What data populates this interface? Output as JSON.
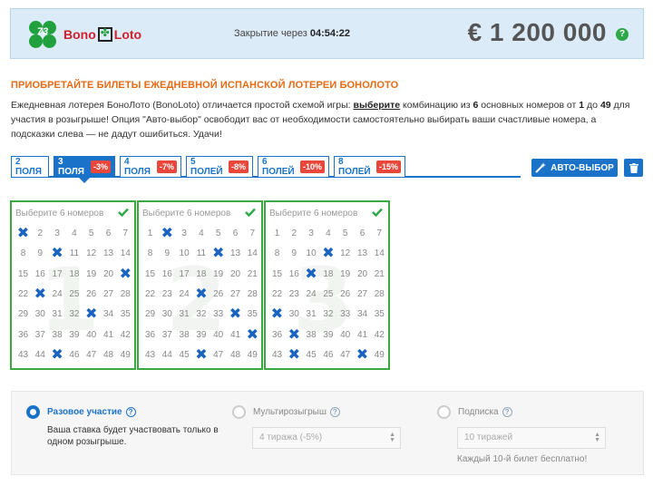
{
  "header": {
    "logo_number": "73",
    "brand_left": "Bono",
    "brand_right": "Loto",
    "closing_label": "Закрытие через",
    "closing_time": "04:54:22",
    "jackpot": "€ 1 200 000",
    "help": "?"
  },
  "title": "ПРИОБРЕТАЙТЕ БИЛЕТЫ ЕЖЕДНЕВНОЙ ИСПАНСКОЙ ЛОТЕРЕИ БОНОЛОТО",
  "description": {
    "p1": "Ежедневная лотерея БоноЛото (BonoLoto) отличается простой схемой игры: ",
    "link": "выберите",
    "p2": " комбинацию из ",
    "n1": "6",
    "p3": " основных номеров от ",
    "n2": "1",
    "p4": " до ",
    "n3": "49",
    "p5": " для участия в розыгрыше! Опция \"Авто-выбор\" освободит вас от необходимости самостоятельно выбирать ваши счастливые номера, а подсказки слева — не дадут ошибиться. Удачи!"
  },
  "tabs": [
    {
      "label": "2 ПОЛЯ",
      "discount": ""
    },
    {
      "label": "3 ПОЛЯ",
      "discount": "-3%"
    },
    {
      "label": "4 ПОЛЯ",
      "discount": "-7%"
    },
    {
      "label": "5 ПОЛЕЙ",
      "discount": "-8%"
    },
    {
      "label": "6 ПОЛЕЙ",
      "discount": "-10%"
    },
    {
      "label": "8 ПОЛЕЙ",
      "discount": "-15%"
    }
  ],
  "active_tab": 1,
  "auto_pick_label": "АВТО-ВЫБОР",
  "grids": [
    {
      "title": "Выберите 6 номеров",
      "watermark": "1",
      "selected": [
        1,
        10,
        21,
        23,
        33,
        45
      ]
    },
    {
      "title": "Выберите 6 номеров",
      "watermark": "2",
      "selected": [
        2,
        12,
        25,
        34,
        42,
        46
      ]
    },
    {
      "title": "Выберите 6 номеров",
      "watermark": "3",
      "selected": [
        11,
        17,
        29,
        37,
        44,
        48
      ]
    }
  ],
  "options": {
    "single": {
      "label": "Разовое участие",
      "desc": "Ваша ставка будет участвовать только в одном розыгрыше."
    },
    "multi": {
      "label": "Мультирозыгрыш",
      "select": "4 тиража (-5%)"
    },
    "subscription": {
      "label": "Подписка",
      "select": "10 тиражей",
      "note": "Каждый 10-й билет бесплатно!"
    }
  },
  "colors": {
    "accent": "#1a73c8",
    "grid_border": "#39a83f",
    "discount": "#e9473b",
    "title": "#e46a14"
  }
}
